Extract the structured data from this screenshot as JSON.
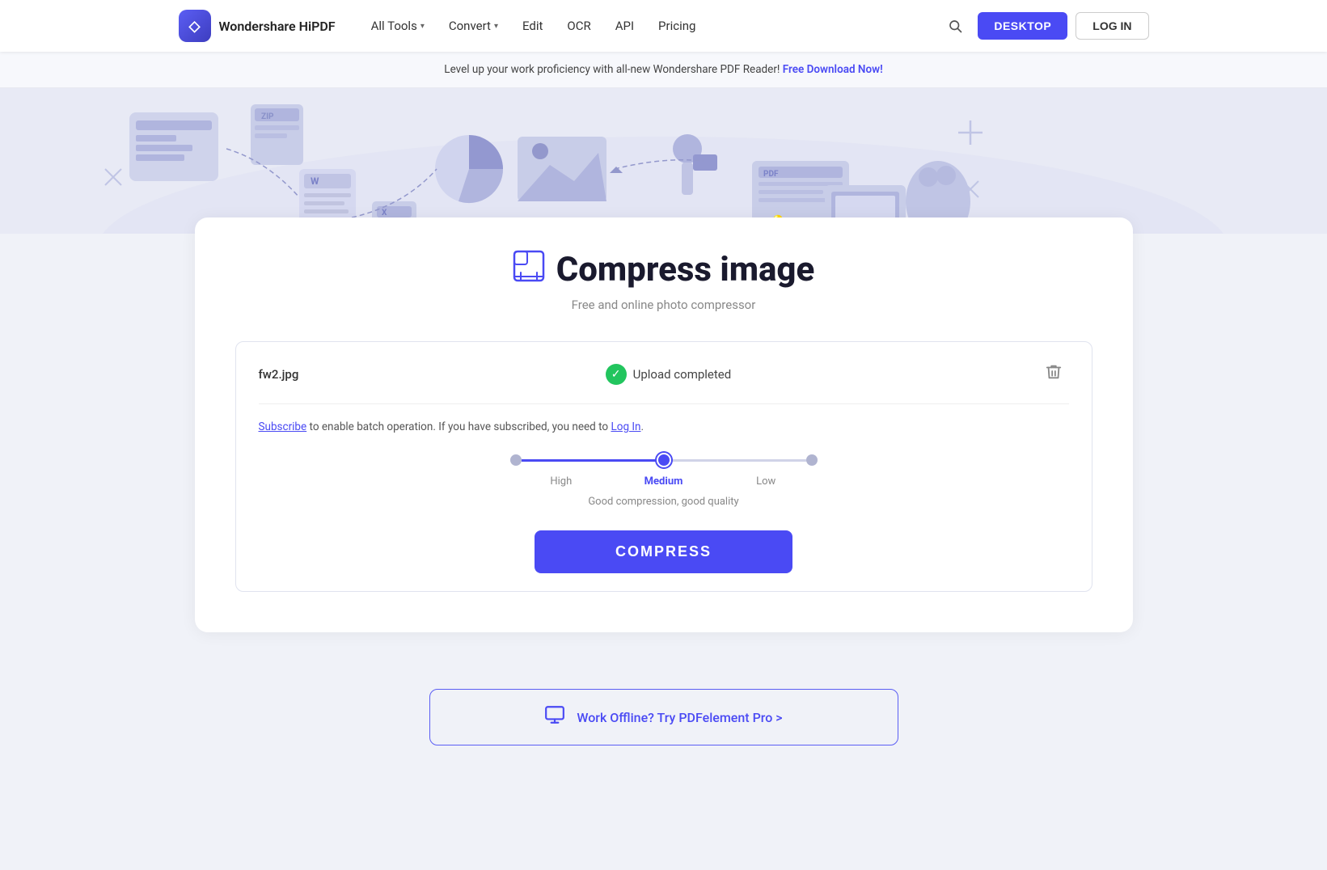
{
  "brand": {
    "name": "Wondershare HiPDF",
    "logo_symbol": "◇"
  },
  "nav": {
    "links": [
      {
        "label": "All Tools",
        "has_dropdown": true
      },
      {
        "label": "Convert",
        "has_dropdown": true
      },
      {
        "label": "Edit",
        "has_dropdown": false
      },
      {
        "label": "OCR",
        "has_dropdown": false
      },
      {
        "label": "API",
        "has_dropdown": false
      },
      {
        "label": "Pricing",
        "has_dropdown": false
      }
    ],
    "desktop_btn": "DESKTOP",
    "login_btn": "LOG IN"
  },
  "banner": {
    "text": "Level up your work proficiency with all-new Wondershare PDF Reader!",
    "link_text": "Free Download Now!",
    "link_url": "#"
  },
  "page": {
    "title": "Compress image",
    "subtitle": "Free and online photo compressor"
  },
  "upload": {
    "file_name": "fw2.jpg",
    "status": "Upload completed",
    "subscribe_text": "to enable batch operation. If you have subscribed, you need to",
    "subscribe_link": "Subscribe",
    "login_link": "Log In"
  },
  "compression": {
    "levels": [
      {
        "label": "High",
        "active": false
      },
      {
        "label": "Medium",
        "active": true
      },
      {
        "label": "Low",
        "active": false
      }
    ],
    "selected": "Medium",
    "description": "Good compression, good quality",
    "button_label": "COMPRESS"
  },
  "offline": {
    "label": "Work Offline? Try PDFelement Pro >"
  }
}
